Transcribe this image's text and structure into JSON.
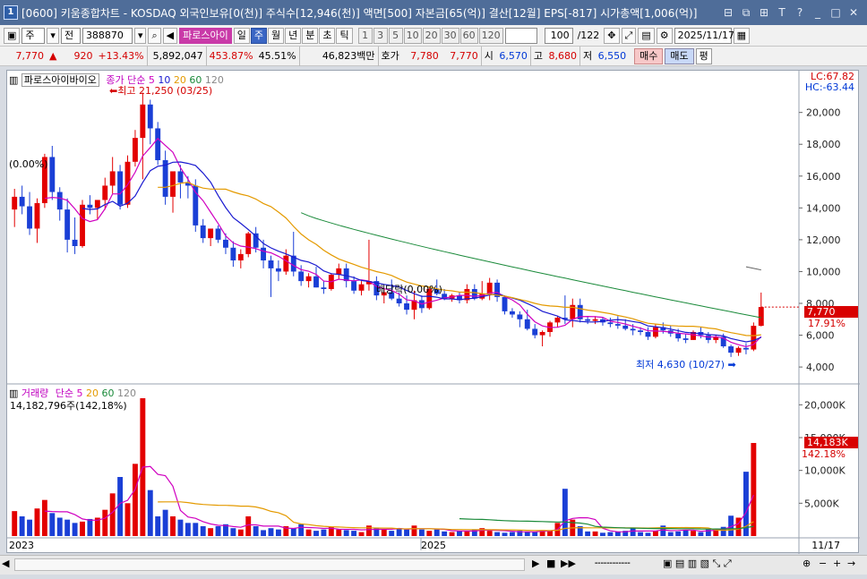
{
  "window": {
    "title": "[0600] 키움종합차트 - KOSDAQ 외국인보유[0(천)] 주식수[12,946(천)] 액면[500] 자본금[65(억)] 결산[12월] EPS[-817] 시가총액[1,006(억)]",
    "icon_label": "1",
    "buttons": [
      "⊟",
      "⧉",
      "⊞",
      "T",
      "?",
      "_",
      "□",
      "✕"
    ]
  },
  "toolbar": {
    "period_select": "주",
    "view_select": "전",
    "code": "388870",
    "stock_name": "파로스아이",
    "period_tabs": [
      "일",
      "주",
      "월",
      "년",
      "분",
      "초",
      "틱"
    ],
    "selected_period": "주",
    "minute_buttons": [
      "1",
      "3",
      "5",
      "10",
      "20",
      "30",
      "60",
      "120"
    ],
    "count": "100",
    "total": "/122",
    "date": "2025/11/17"
  },
  "quote": {
    "price": "7,770",
    "arrow": "▲",
    "change": "920",
    "change_pct": "+13.43%",
    "volume": "5,892,047",
    "volume_ratio": "453.87%",
    "turnover": "45.51%",
    "amount": "46,823백만",
    "hoga_label": "호가",
    "hoga1": "7,780",
    "hoga2": "7,770",
    "open_label": "시",
    "open": "6,570",
    "high_label": "고",
    "high": "8,680",
    "low_label": "저",
    "low": "6,550",
    "buy": "매수",
    "sell": "매도",
    "eval": "평"
  },
  "price_panel": {
    "name": "파로스아이바이오",
    "ma_label": "종가 단순",
    "ma_periods": [
      "5",
      "10",
      "20",
      "60",
      "120"
    ],
    "ma_colors": [
      "#d000c0",
      "#1a1ad0",
      "#e49a00",
      "#1a8a3a",
      "#888888"
    ],
    "lc": "LC:67.82",
    "hc": "HC:-63.44",
    "max_label": "최고 21,250 (03/25)",
    "min_label": "최저 4,630 (10/27)",
    "left_label": "(0.00%)",
    "div_label": "배당락(0.00%)",
    "last_price": "7,770",
    "last_pct": "17.91%",
    "y_ticks": [
      "20,000",
      "18,000",
      "16,000",
      "14,000",
      "12,000",
      "10,000",
      "8,000",
      "6,000",
      "4,000"
    ]
  },
  "volume_panel": {
    "title": "거래량",
    "ma_label": "단순",
    "ma_periods": [
      "5",
      "20",
      "60",
      "120"
    ],
    "info": "14,182,796주(142,18%)",
    "last_vol": "14,183K",
    "last_pct": "142.18%",
    "y_ticks": [
      "20,000K",
      "15,000K",
      "10,000K",
      "5,000K"
    ]
  },
  "x_axis": {
    "labels": [
      "2023",
      "2025"
    ],
    "date_label": "11/17"
  },
  "chart_data": {
    "type": "candlestick",
    "interval": "weekly",
    "y_range": [
      4000,
      21250
    ],
    "candles": [
      [
        13900,
        15200,
        12800,
        14700
      ],
      [
        14700,
        15400,
        13600,
        14100
      ],
      [
        14100,
        15000,
        12300,
        12700
      ],
      [
        12700,
        14600,
        11800,
        14300
      ],
      [
        14300,
        17400,
        14000,
        17200
      ],
      [
        17200,
        17900,
        14500,
        15000
      ],
      [
        15000,
        15300,
        13200,
        13900
      ],
      [
        13900,
        14600,
        11200,
        12000
      ],
      [
        12000,
        13400,
        11100,
        11600
      ],
      [
        11600,
        14500,
        11500,
        14200
      ],
      [
        14200,
        14800,
        13600,
        14000
      ],
      [
        14000,
        14400,
        13300,
        14500
      ],
      [
        14500,
        15900,
        13900,
        15400
      ],
      [
        15400,
        17200,
        14900,
        16300
      ],
      [
        16300,
        16700,
        13900,
        14200
      ],
      [
        14200,
        17300,
        14000,
        16900
      ],
      [
        16900,
        18900,
        16600,
        18400
      ],
      [
        18400,
        21250,
        15800,
        20500
      ],
      [
        20500,
        20800,
        18000,
        19000
      ],
      [
        19000,
        19400,
        16700,
        17000
      ],
      [
        17000,
        17600,
        14200,
        14700
      ],
      [
        14700,
        16000,
        13700,
        16300
      ],
      [
        16300,
        16700,
        14600,
        15600
      ],
      [
        15600,
        16000,
        14600,
        15400
      ],
      [
        15400,
        15800,
        12500,
        12900
      ],
      [
        12900,
        13300,
        11800,
        12100
      ],
      [
        12100,
        12600,
        11600,
        12700
      ],
      [
        12700,
        12900,
        11800,
        12000
      ],
      [
        12000,
        12400,
        11100,
        11500
      ],
      [
        11500,
        11900,
        10300,
        10700
      ],
      [
        10700,
        11400,
        10200,
        11100
      ],
      [
        11100,
        12500,
        10900,
        12400
      ],
      [
        12400,
        12800,
        11200,
        11500
      ],
      [
        11500,
        12000,
        10200,
        10700
      ],
      [
        10700,
        11000,
        8400,
        10200
      ],
      [
        10200,
        10700,
        9400,
        10000
      ],
      [
        10000,
        11400,
        9800,
        11000
      ],
      [
        11000,
        12500,
        9700,
        10000
      ],
      [
        10000,
        10400,
        9100,
        9400
      ],
      [
        9400,
        9900,
        9000,
        9700
      ],
      [
        9700,
        10300,
        9000,
        9000
      ],
      [
        9000,
        9400,
        8600,
        8900
      ],
      [
        8900,
        9900,
        8800,
        9800
      ],
      [
        9800,
        10500,
        9500,
        10200
      ],
      [
        10200,
        10500,
        9000,
        9400
      ],
      [
        9400,
        9700,
        8600,
        8800
      ],
      [
        8800,
        9400,
        8500,
        9200
      ],
      [
        9200,
        12000,
        8800,
        9400
      ],
      [
        9400,
        9700,
        8200,
        8500
      ],
      [
        8500,
        8900,
        8000,
        8700
      ],
      [
        8700,
        9500,
        8200,
        8300
      ],
      [
        8300,
        8700,
        7800,
        8000
      ],
      [
        8000,
        8500,
        7300,
        7600
      ],
      [
        7600,
        8800,
        7000,
        8200
      ],
      [
        8200,
        8500,
        7400,
        7700
      ],
      [
        7700,
        9000,
        7600,
        8900
      ],
      [
        8900,
        9500,
        8500,
        8600
      ],
      [
        8600,
        8900,
        8200,
        8300
      ],
      [
        8300,
        8600,
        8100,
        8500
      ],
      [
        8500,
        8700,
        8000,
        8200
      ],
      [
        8200,
        9200,
        8000,
        8900
      ],
      [
        8900,
        9200,
        8200,
        8300
      ],
      [
        8300,
        9400,
        8200,
        8600
      ],
      [
        8600,
        9600,
        8200,
        9300
      ],
      [
        9300,
        9500,
        8100,
        8400
      ],
      [
        8400,
        8500,
        7300,
        7500
      ],
      [
        7500,
        7700,
        7100,
        7300
      ],
      [
        7300,
        7500,
        6500,
        7000
      ],
      [
        7000,
        7600,
        6300,
        6400
      ],
      [
        6400,
        6700,
        5800,
        6000
      ],
      [
        6000,
        6300,
        5300,
        6200
      ],
      [
        6200,
        6900,
        5900,
        6800
      ],
      [
        6800,
        7200,
        6500,
        7100
      ],
      [
        7100,
        8500,
        6700,
        7000
      ],
      [
        7000,
        8300,
        6500,
        7900
      ],
      [
        7900,
        8300,
        6800,
        7000
      ],
      [
        7000,
        7200,
        6700,
        6900
      ],
      [
        6900,
        7200,
        6700,
        7000
      ],
      [
        7000,
        7100,
        6600,
        6800
      ],
      [
        6800,
        7100,
        6500,
        6700
      ],
      [
        6700,
        7200,
        6400,
        6600
      ],
      [
        6600,
        7000,
        6300,
        6400
      ],
      [
        6400,
        6700,
        6000,
        6300
      ],
      [
        6300,
        6500,
        6000,
        6200
      ],
      [
        6200,
        6500,
        5700,
        5900
      ],
      [
        5900,
        6700,
        5800,
        6500
      ],
      [
        6500,
        6800,
        6100,
        6300
      ],
      [
        6300,
        6600,
        5900,
        6100
      ],
      [
        6100,
        6400,
        5600,
        5800
      ],
      [
        5800,
        6100,
        5500,
        5700
      ],
      [
        5700,
        6300,
        5700,
        6200
      ],
      [
        6200,
        6500,
        5800,
        6000
      ],
      [
        6000,
        6200,
        5500,
        5700
      ],
      [
        5700,
        6000,
        5500,
        5900
      ],
      [
        5900,
        6100,
        5200,
        5300
      ],
      [
        5300,
        5400,
        4630,
        4900
      ],
      [
        4900,
        5300,
        4700,
        5200
      ],
      [
        5200,
        5500,
        4800,
        5100
      ],
      [
        5100,
        6800,
        5000,
        6590
      ],
      [
        6590,
        8680,
        6550,
        7770
      ]
    ],
    "volume_k": [
      3800,
      3000,
      2500,
      4200,
      5500,
      3500,
      2800,
      2500,
      2000,
      2200,
      2600,
      2800,
      4000,
      6500,
      9000,
      5000,
      11000,
      21000,
      7000,
      3000,
      4000,
      3000,
      2500,
      2000,
      2000,
      1500,
      1200,
      1500,
      1800,
      1200,
      1000,
      3000,
      1500,
      900,
      1200,
      1000,
      1500,
      1200,
      1800,
      1000,
      800,
      1000,
      1400,
      1000,
      900,
      800,
      600,
      1600,
      1200,
      1000,
      800,
      1200,
      1000,
      1600,
      1000,
      800,
      1000,
      700,
      600,
      800,
      700,
      1000,
      1200,
      800,
      600,
      500,
      600,
      800,
      700,
      600,
      900,
      800,
      2000,
      7200,
      2500,
      1500,
      700,
      700,
      500,
      600,
      700,
      800,
      1200,
      600,
      500,
      800,
      1600,
      600,
      700,
      900,
      800,
      600,
      1000,
      1100,
      1400,
      3100,
      2800,
      9800,
      14183
    ],
    "ma_last": {
      "ma5": 6300,
      "ma20": 6100,
      "ma60": 7100
    },
    "ma60_start": 13700,
    "ma60_end": 7100
  }
}
